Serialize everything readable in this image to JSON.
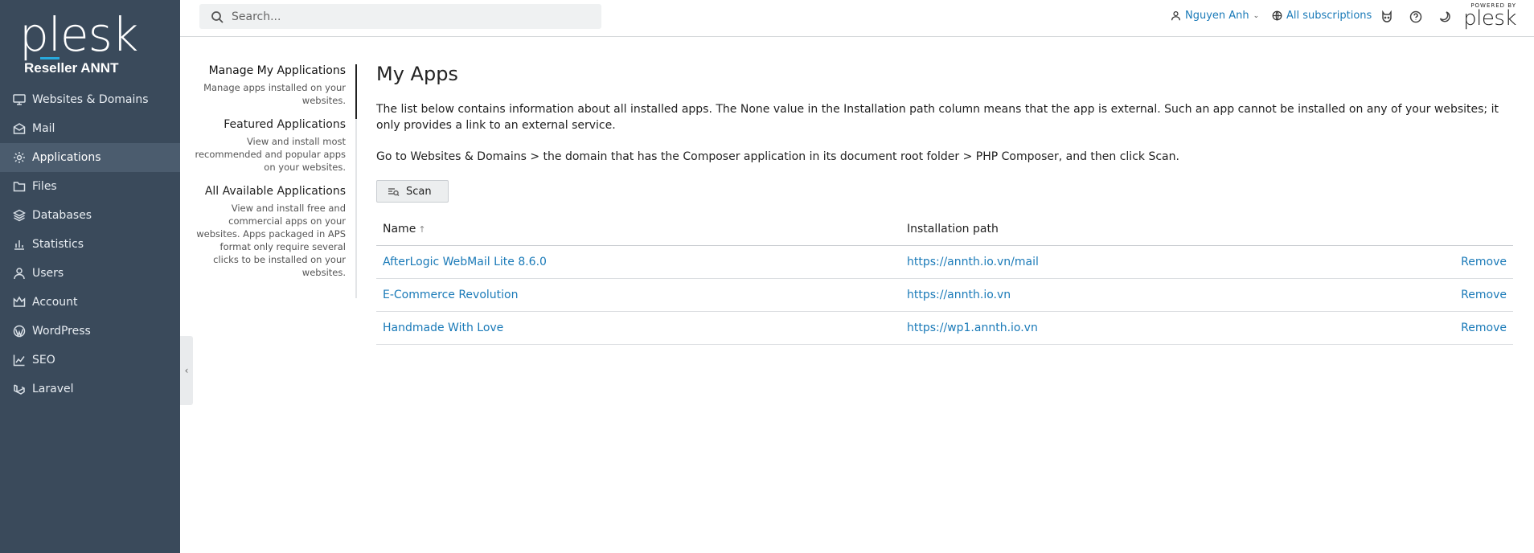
{
  "sidebar": {
    "logo": "plesk",
    "account_name": "Reseller ANNT",
    "items": [
      {
        "label": "Websites & Domains",
        "icon": "monitor-icon"
      },
      {
        "label": "Mail",
        "icon": "envelope-icon"
      },
      {
        "label": "Applications",
        "icon": "gear-icon",
        "active": true
      },
      {
        "label": "Files",
        "icon": "folder-icon"
      },
      {
        "label": "Databases",
        "icon": "layers-icon"
      },
      {
        "label": "Statistics",
        "icon": "bar-chart-icon"
      },
      {
        "label": "Users",
        "icon": "user-icon"
      },
      {
        "label": "Account",
        "icon": "crown-icon"
      },
      {
        "label": "WordPress",
        "icon": "wordpress-icon"
      },
      {
        "label": "SEO",
        "icon": "trend-icon"
      },
      {
        "label": "Laravel",
        "icon": "laravel-icon"
      }
    ]
  },
  "topbar": {
    "search_placeholder": "Search...",
    "user_name": "Nguyen Anh",
    "subscriptions": "All subscriptions",
    "powered_by": "POWERED BY",
    "powered_logo": "plesk"
  },
  "subnav": {
    "items": [
      {
        "title": "Manage My Applications",
        "desc": "Manage apps installed on your websites."
      },
      {
        "title": "Featured Applications",
        "desc": "View and install most recommended and popular apps on your websites."
      },
      {
        "title": "All Available Applications",
        "desc": "View and install free and commercial apps on your websites. Apps packaged in APS format only require several clicks to be installed on your websites."
      }
    ]
  },
  "main": {
    "title": "My Apps",
    "intro": "The list below contains information about all installed apps. The None value in the Installation path column means that the app is external. Such an app cannot be installed on any of your websites; it only provides a link to an external service.",
    "hint": "Go to Websites & Domains > the domain that has the Composer application in its document root folder > PHP Composer, and then click Scan.",
    "scan_label": "Scan",
    "table": {
      "col_name": "Name",
      "col_path": "Installation path",
      "rows": [
        {
          "name": "AfterLogic WebMail Lite 8.6.0",
          "path": "https://annth.io.vn/mail",
          "action": "Remove"
        },
        {
          "name": "E-Commerce Revolution",
          "path": "https://annth.io.vn",
          "action": "Remove"
        },
        {
          "name": "Handmade With Love",
          "path": "https://wp1.annth.io.vn",
          "action": "Remove"
        }
      ]
    }
  },
  "colors": {
    "sidebar_bg": "#3a4a5b",
    "sidebar_active": "#4b5c6e",
    "link": "#1a7ab8",
    "accent": "#28aade"
  }
}
